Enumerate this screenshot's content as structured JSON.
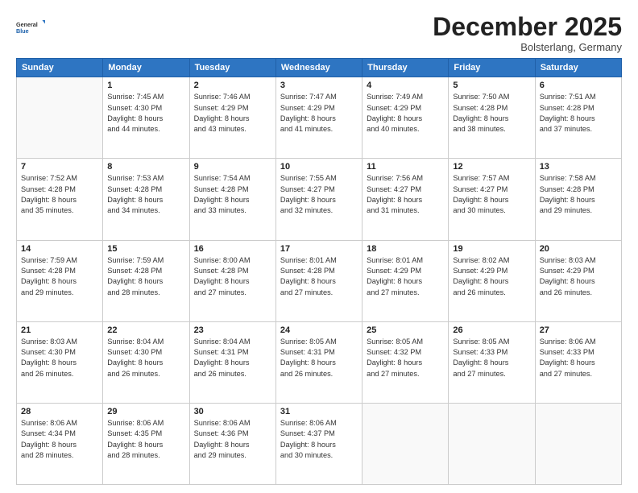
{
  "logo": {
    "general": "General",
    "blue": "Blue"
  },
  "header": {
    "month": "December 2025",
    "location": "Bolsterlang, Germany"
  },
  "days_of_week": [
    "Sunday",
    "Monday",
    "Tuesday",
    "Wednesday",
    "Thursday",
    "Friday",
    "Saturday"
  ],
  "weeks": [
    [
      {
        "day": null,
        "info": null
      },
      {
        "day": "1",
        "info": "Sunrise: 7:45 AM\nSunset: 4:30 PM\nDaylight: 8 hours\nand 44 minutes."
      },
      {
        "day": "2",
        "info": "Sunrise: 7:46 AM\nSunset: 4:29 PM\nDaylight: 8 hours\nand 43 minutes."
      },
      {
        "day": "3",
        "info": "Sunrise: 7:47 AM\nSunset: 4:29 PM\nDaylight: 8 hours\nand 41 minutes."
      },
      {
        "day": "4",
        "info": "Sunrise: 7:49 AM\nSunset: 4:29 PM\nDaylight: 8 hours\nand 40 minutes."
      },
      {
        "day": "5",
        "info": "Sunrise: 7:50 AM\nSunset: 4:28 PM\nDaylight: 8 hours\nand 38 minutes."
      },
      {
        "day": "6",
        "info": "Sunrise: 7:51 AM\nSunset: 4:28 PM\nDaylight: 8 hours\nand 37 minutes."
      }
    ],
    [
      {
        "day": "7",
        "info": "Sunrise: 7:52 AM\nSunset: 4:28 PM\nDaylight: 8 hours\nand 35 minutes."
      },
      {
        "day": "8",
        "info": "Sunrise: 7:53 AM\nSunset: 4:28 PM\nDaylight: 8 hours\nand 34 minutes."
      },
      {
        "day": "9",
        "info": "Sunrise: 7:54 AM\nSunset: 4:28 PM\nDaylight: 8 hours\nand 33 minutes."
      },
      {
        "day": "10",
        "info": "Sunrise: 7:55 AM\nSunset: 4:27 PM\nDaylight: 8 hours\nand 32 minutes."
      },
      {
        "day": "11",
        "info": "Sunrise: 7:56 AM\nSunset: 4:27 PM\nDaylight: 8 hours\nand 31 minutes."
      },
      {
        "day": "12",
        "info": "Sunrise: 7:57 AM\nSunset: 4:27 PM\nDaylight: 8 hours\nand 30 minutes."
      },
      {
        "day": "13",
        "info": "Sunrise: 7:58 AM\nSunset: 4:28 PM\nDaylight: 8 hours\nand 29 minutes."
      }
    ],
    [
      {
        "day": "14",
        "info": "Sunrise: 7:59 AM\nSunset: 4:28 PM\nDaylight: 8 hours\nand 29 minutes."
      },
      {
        "day": "15",
        "info": "Sunrise: 7:59 AM\nSunset: 4:28 PM\nDaylight: 8 hours\nand 28 minutes."
      },
      {
        "day": "16",
        "info": "Sunrise: 8:00 AM\nSunset: 4:28 PM\nDaylight: 8 hours\nand 27 minutes."
      },
      {
        "day": "17",
        "info": "Sunrise: 8:01 AM\nSunset: 4:28 PM\nDaylight: 8 hours\nand 27 minutes."
      },
      {
        "day": "18",
        "info": "Sunrise: 8:01 AM\nSunset: 4:29 PM\nDaylight: 8 hours\nand 27 minutes."
      },
      {
        "day": "19",
        "info": "Sunrise: 8:02 AM\nSunset: 4:29 PM\nDaylight: 8 hours\nand 26 minutes."
      },
      {
        "day": "20",
        "info": "Sunrise: 8:03 AM\nSunset: 4:29 PM\nDaylight: 8 hours\nand 26 minutes."
      }
    ],
    [
      {
        "day": "21",
        "info": "Sunrise: 8:03 AM\nSunset: 4:30 PM\nDaylight: 8 hours\nand 26 minutes."
      },
      {
        "day": "22",
        "info": "Sunrise: 8:04 AM\nSunset: 4:30 PM\nDaylight: 8 hours\nand 26 minutes."
      },
      {
        "day": "23",
        "info": "Sunrise: 8:04 AM\nSunset: 4:31 PM\nDaylight: 8 hours\nand 26 minutes."
      },
      {
        "day": "24",
        "info": "Sunrise: 8:05 AM\nSunset: 4:31 PM\nDaylight: 8 hours\nand 26 minutes."
      },
      {
        "day": "25",
        "info": "Sunrise: 8:05 AM\nSunset: 4:32 PM\nDaylight: 8 hours\nand 27 minutes."
      },
      {
        "day": "26",
        "info": "Sunrise: 8:05 AM\nSunset: 4:33 PM\nDaylight: 8 hours\nand 27 minutes."
      },
      {
        "day": "27",
        "info": "Sunrise: 8:06 AM\nSunset: 4:33 PM\nDaylight: 8 hours\nand 27 minutes."
      }
    ],
    [
      {
        "day": "28",
        "info": "Sunrise: 8:06 AM\nSunset: 4:34 PM\nDaylight: 8 hours\nand 28 minutes."
      },
      {
        "day": "29",
        "info": "Sunrise: 8:06 AM\nSunset: 4:35 PM\nDaylight: 8 hours\nand 28 minutes."
      },
      {
        "day": "30",
        "info": "Sunrise: 8:06 AM\nSunset: 4:36 PM\nDaylight: 8 hours\nand 29 minutes."
      },
      {
        "day": "31",
        "info": "Sunrise: 8:06 AM\nSunset: 4:37 PM\nDaylight: 8 hours\nand 30 minutes."
      },
      {
        "day": null,
        "info": null
      },
      {
        "day": null,
        "info": null
      },
      {
        "day": null,
        "info": null
      }
    ]
  ]
}
